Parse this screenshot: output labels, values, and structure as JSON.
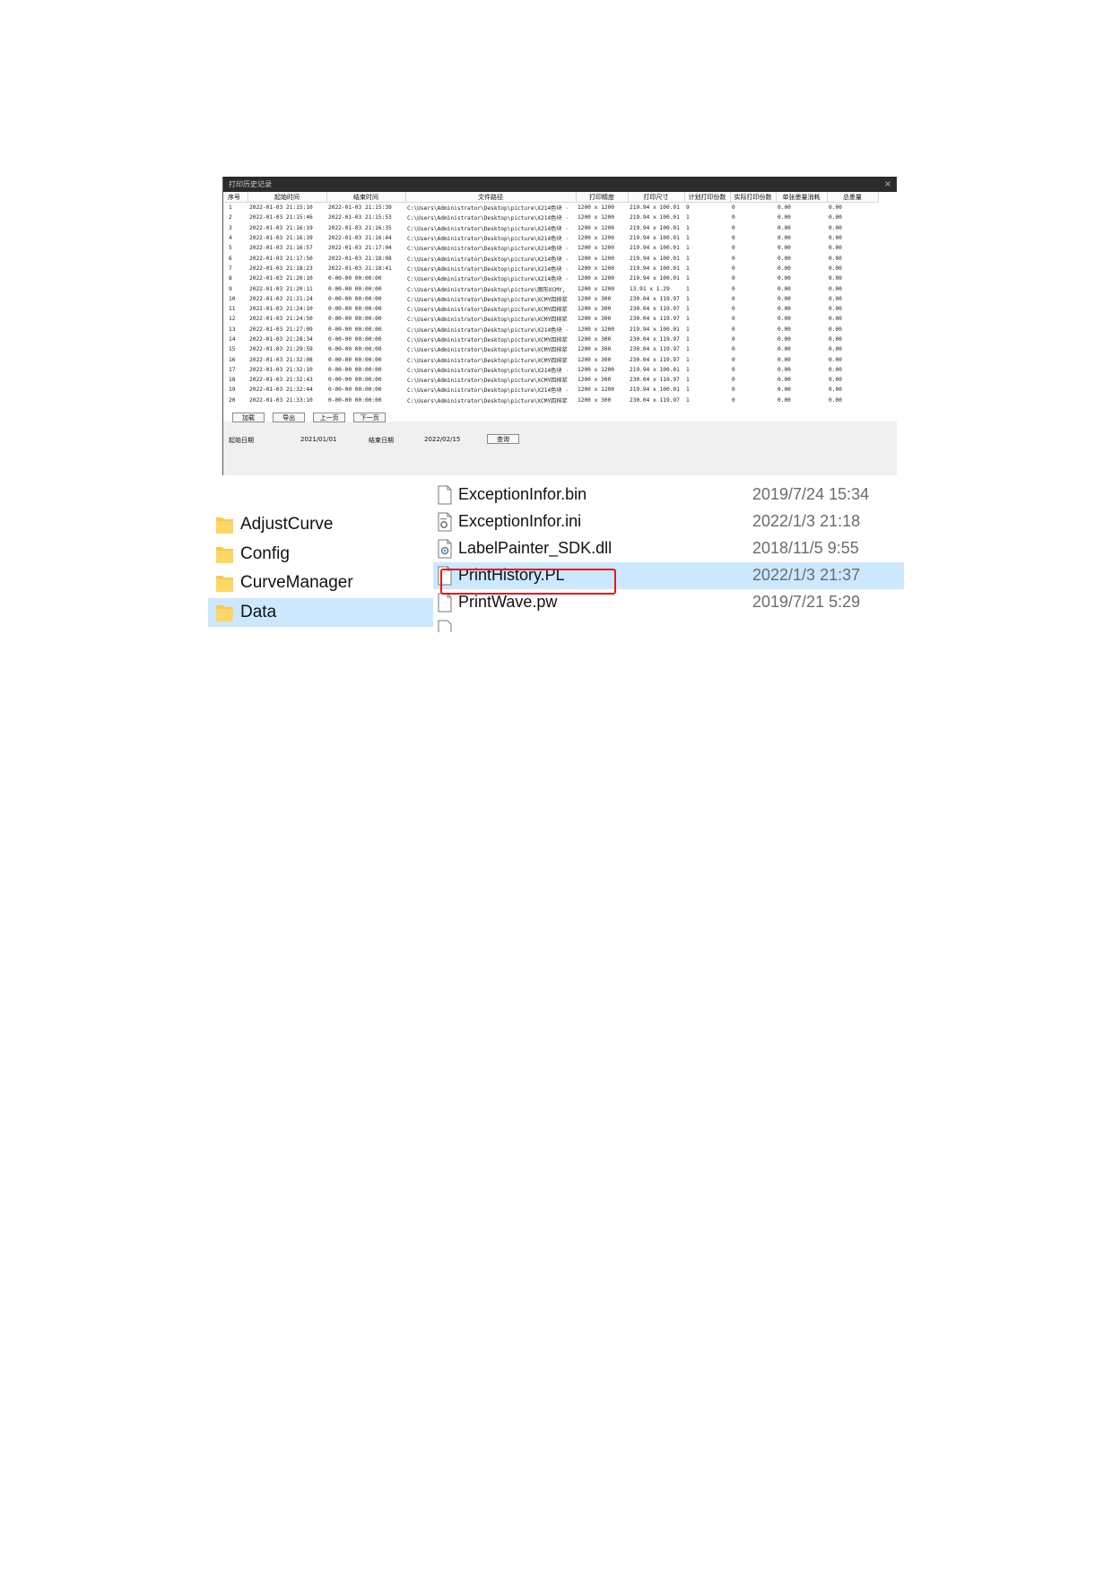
{
  "dialog": {
    "title": "打印历史记录",
    "close_glyph": "×",
    "columns": [
      "序号",
      "起始时间",
      "结束时间",
      "文件路径",
      "打印精度",
      "打印尺寸",
      "计划打印份数",
      "实际打印份数",
      "单张墨量消耗",
      "总墨量"
    ],
    "rows": [
      [
        "1",
        "2022-01-03 21:15:10",
        "2022-01-03 21:15:39",
        "C:\\Users\\Administrator\\Desktop\\picture\\X214色块 ·",
        "1200 x 1200",
        "219.94 x 100.01",
        "9",
        "0",
        "0.00",
        "0.00"
      ],
      [
        "2",
        "2022-01-03 21:15:46",
        "2022-01-03 21:15:53",
        "C:\\Users\\Administrator\\Desktop\\picture\\X214色块 ·",
        "1200 x 1200",
        "219.94 x 100.01",
        "1",
        "0",
        "0.00",
        "0.00"
      ],
      [
        "3",
        "2022-01-03 21:16:19",
        "2022-01-03 21:16:35",
        "C:\\Users\\Administrator\\Desktop\\picture\\X214色块 ·",
        "1200 x 1200",
        "219.94 x 100.01",
        "1",
        "0",
        "0.00",
        "0.00"
      ],
      [
        "4",
        "2022-01-03 21:16:39",
        "2022-01-03 21:16:44",
        "C:\\Users\\Administrator\\Desktop\\picture\\X214色块 ·",
        "1200 x 1200",
        "219.94 x 100.01",
        "1",
        "0",
        "0.00",
        "0.00"
      ],
      [
        "5",
        "2022-01-03 21:16:57",
        "2022-01-03 21:17:04",
        "C:\\Users\\Administrator\\Desktop\\picture\\X214色块 ·",
        "1200 x 1200",
        "219.94 x 100.01",
        "1",
        "0",
        "0.00",
        "0.00"
      ],
      [
        "6",
        "2022-01-03 21:17:50",
        "2022-01-03 21:18:08",
        "C:\\Users\\Administrator\\Desktop\\picture\\X214色块 ·",
        "1200 x 1200",
        "219.94 x 100.01",
        "1",
        "0",
        "0.00",
        "0.00"
      ],
      [
        "7",
        "2022-01-03 21:18:23",
        "2022-01-03 21:18:41",
        "C:\\Users\\Administrator\\Desktop\\picture\\X214色块 ·",
        "1200 x 1200",
        "219.94 x 100.01",
        "1",
        "0",
        "0.00",
        "0.00"
      ],
      [
        "8",
        "2022-01-03 21:20:10",
        "0-00-00 00:00:00",
        "C:\\Users\\Administrator\\Desktop\\picture\\X214色块 ·",
        "1200 x 1200",
        "219.94 x 100.01",
        "1",
        "0",
        "0.00",
        "0.00"
      ],
      [
        "9",
        "2022-01-03 21:20:11",
        "0-00-00 00:00:00",
        "C:\\Users\\Administrator\\Desktop\\picture\\图形XCMY,",
        "1200 x 1200",
        "13.91 x 1.29",
        "1",
        "0",
        "0.00",
        "0.00"
      ],
      [
        "10",
        "2022-01-03 21:21:24",
        "0-00-00 00:00:00",
        "C:\\Users\\Administrator\\Desktop\\picture\\XCMY四排浆",
        "1200 x 300",
        "230.04 x 119.97",
        "1",
        "0",
        "0.00",
        "0.00"
      ],
      [
        "11",
        "2022-01-03 21:24:10",
        "0-00-00 00:00:00",
        "C:\\Users\\Administrator\\Desktop\\picture\\XCMY四排浆",
        "1200 x 300",
        "230.04 x 119.97",
        "1",
        "0",
        "0.00",
        "0.00"
      ],
      [
        "12",
        "2022-01-03 21:24:50",
        "0-00-00 00:00:00",
        "C:\\Users\\Administrator\\Desktop\\picture\\XCMY四排浆",
        "1200 x 300",
        "230.04 x 119.97",
        "1",
        "0",
        "0.00",
        "0.00"
      ],
      [
        "13",
        "2022-01-03 21:27:09",
        "0-00-00 00:00:00",
        "C:\\Users\\Administrator\\Desktop\\picture\\X214色块 ·",
        "1200 x 1200",
        "219.94 x 100.01",
        "1",
        "0",
        "0.00",
        "0.00"
      ],
      [
        "14",
        "2022-01-03 21:28:34",
        "0-00-00 00:00:00",
        "C:\\Users\\Administrator\\Desktop\\picture\\XCMY四排浆",
        "1200 x 300",
        "230.04 x 119.97",
        "1",
        "0",
        "0.00",
        "0.00"
      ],
      [
        "15",
        "2022-01-03 21:29:59",
        "0-00-00 00:00:00",
        "C:\\Users\\Administrator\\Desktop\\picture\\XCMY四排浆",
        "1200 x 300",
        "230.04 x 119.97",
        "1",
        "0",
        "0.00",
        "0.00"
      ],
      [
        "16",
        "2022-01-03 21:32:08",
        "0-00-00 00:00:00",
        "C:\\Users\\Administrator\\Desktop\\picture\\XCMY四排浆",
        "1200 x 300",
        "230.04 x 119.97",
        "1",
        "0",
        "0.00",
        "0.00"
      ],
      [
        "17",
        "2022-01-03 21:32:10",
        "0-00-00 00:00:00",
        "C:\\Users\\Administrator\\Desktop\\picture\\X214色块 ·",
        "1200 x 1200",
        "219.94 x 100.01",
        "1",
        "0",
        "0.00",
        "0.00"
      ],
      [
        "18",
        "2022-01-03 21:32:43",
        "0-00-00 00:00:00",
        "C:\\Users\\Administrator\\Desktop\\picture\\XCMY四排浆",
        "1200 x 300",
        "230.04 x 119.97",
        "1",
        "0",
        "0.00",
        "0.00"
      ],
      [
        "19",
        "2022-01-03 21:32:44",
        "0-00-00 00:00:00",
        "C:\\Users\\Administrator\\Desktop\\picture\\X214色块 ·",
        "1200 x 1200",
        "219.94 x 100.01",
        "1",
        "0",
        "0.00",
        "0.00"
      ],
      [
        "20",
        "2022-01-03 21:33:10",
        "0-00-00 00:00:00",
        "C:\\Users\\Administrator\\Desktop\\picture\\XCMY四排浆",
        "1200 x 300",
        "230.04 x 119.97",
        "1",
        "0",
        "0.00",
        "0.00"
      ]
    ],
    "buttons": {
      "load": "加载",
      "export": "导出",
      "prev_page": "上一页",
      "next_page": "下一页",
      "query": "查询"
    },
    "filter": {
      "start_label": "起始日期",
      "start_value": "2021/01/01",
      "end_label": "结束日期",
      "end_value": "2022/02/15"
    }
  },
  "explorer": {
    "folders": [
      {
        "name": "AdjustCurve",
        "selected": false
      },
      {
        "name": "Config",
        "selected": false
      },
      {
        "name": "CurveManager",
        "selected": false
      },
      {
        "name": "Data",
        "selected": true
      }
    ],
    "files": [
      {
        "name": "ExceptionInfor.bin",
        "date": "2019/7/24 15:34",
        "icon": "blank-file-icon",
        "selected": false
      },
      {
        "name": "ExceptionInfor.ini",
        "date": "2022/1/3 21:18",
        "icon": "settings-file-icon",
        "selected": false
      },
      {
        "name": "LabelPainter_SDK.dll",
        "date": "2018/11/5 9:55",
        "icon": "dll-file-icon",
        "selected": false
      },
      {
        "name": "PrintHistory.PL",
        "date": "2022/1/3 21:37",
        "icon": "blank-file-icon",
        "selected": true
      },
      {
        "name": "PrintWave.pw",
        "date": "2019/7/21 5:29",
        "icon": "blank-file-icon",
        "selected": false
      }
    ],
    "colors": {
      "selection": "#cce8ff",
      "highlight_box": "#e11b1b",
      "folder": "#f8c94c"
    }
  }
}
